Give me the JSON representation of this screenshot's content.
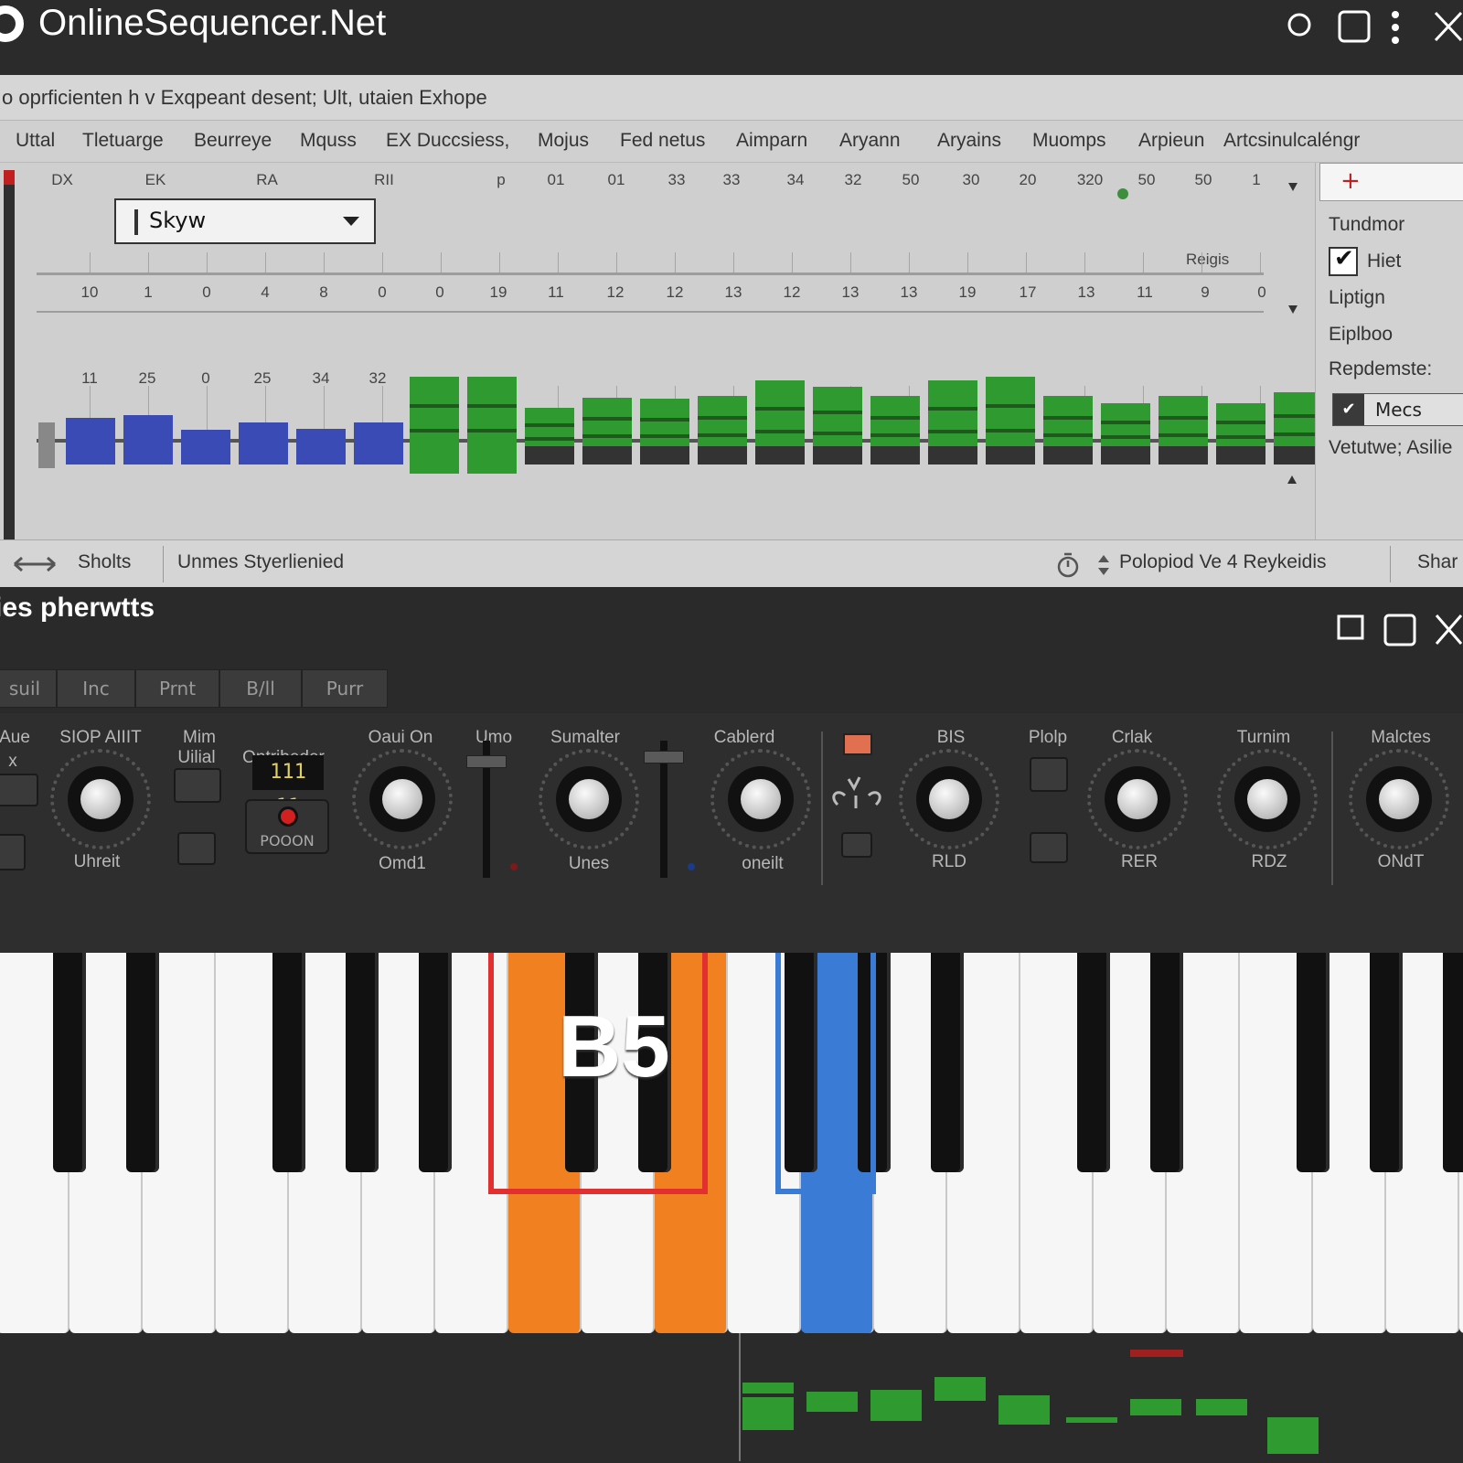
{
  "window": {
    "title": "OnlineSequencer.Net"
  },
  "sequencer": {
    "subtitle": "o oprficienten h v  Exqpeant desent; Ult, utaien Exhope",
    "columns": [
      "Uttal",
      "Tletuarge",
      "Beurreye",
      "Mquss",
      "EX Duccsiess,",
      "Mojus",
      "Fed netus",
      "Aimparn",
      "Aryann",
      "Aryains",
      "Muomps",
      "Arpieun",
      "Artcsinulcaléngr"
    ],
    "top_row": [
      "DX",
      "EK",
      "RA",
      "RII",
      "p",
      "01",
      "01",
      "33",
      "33",
      "34",
      "32",
      "50",
      "30",
      "20",
      "320",
      "50",
      "50",
      "1"
    ],
    "dropdown_value": "Skyw",
    "range_label": "Reigis",
    "ruler_values": [
      "10",
      "1",
      "0",
      "4",
      "8",
      "0",
      "0",
      "19",
      "11",
      "12",
      "12",
      "13",
      "12",
      "13",
      "13",
      "19",
      "17",
      "13",
      "11",
      "9",
      "0"
    ],
    "note_labels": [
      "11",
      "25",
      "0",
      "25",
      "34",
      "32"
    ],
    "velocity": {
      "blue": [
        0.62,
        0.68,
        0.38,
        0.52,
        0.4,
        0.52
      ],
      "green": [
        1.0,
        1.0,
        0.55,
        0.7,
        0.68,
        0.72,
        0.95,
        0.85,
        0.72,
        0.95,
        1.0,
        0.72,
        0.62,
        0.72,
        0.62,
        0.78
      ]
    }
  },
  "sidepanel": {
    "items": [
      "Tundmor",
      "Hiet",
      "Liptign",
      "Eiplboo",
      "Repdemste:"
    ],
    "checkbox_label": "Hiet",
    "checkbox_checked": true,
    "select_label": "Mecs",
    "footer": "Vetutwe; Asilie"
  },
  "status": {
    "left_label": "Sholts",
    "mid_label": "Unmes Styerlienied",
    "right_label": "Polopiod  Ve 4 Reykeidis",
    "far_right": "Shar"
  },
  "synth": {
    "title": "ies pherwtts",
    "tabs": [
      "suil",
      "Inc",
      "Prnt",
      "B/ll",
      "Purr"
    ],
    "top_labels": [
      "Aue",
      "SIOP AIIIT",
      "Mim",
      "Uilial",
      "Ontribeder",
      "Oaui On",
      "Umo",
      "Sumalter",
      "Cablerd",
      "BIS",
      "Plolp",
      "Crlak",
      "Turnim",
      "Malctes"
    ],
    "bottom_labels": [
      "Uhreit",
      "Omd1",
      "Unes",
      "oneilt",
      "RLD",
      "RER",
      "RDZ",
      "ONdT"
    ],
    "small_x": "x",
    "lcd_value": "111 11",
    "rec_label": "POOON",
    "fader_levels": [
      0.88,
      0.92
    ]
  },
  "keyboard": {
    "highlighted_note": "B5",
    "colors": {
      "red": "#e23030",
      "orange": "#f08020",
      "blue": "#3a7bd5",
      "green": "#2f9a2f"
    }
  }
}
